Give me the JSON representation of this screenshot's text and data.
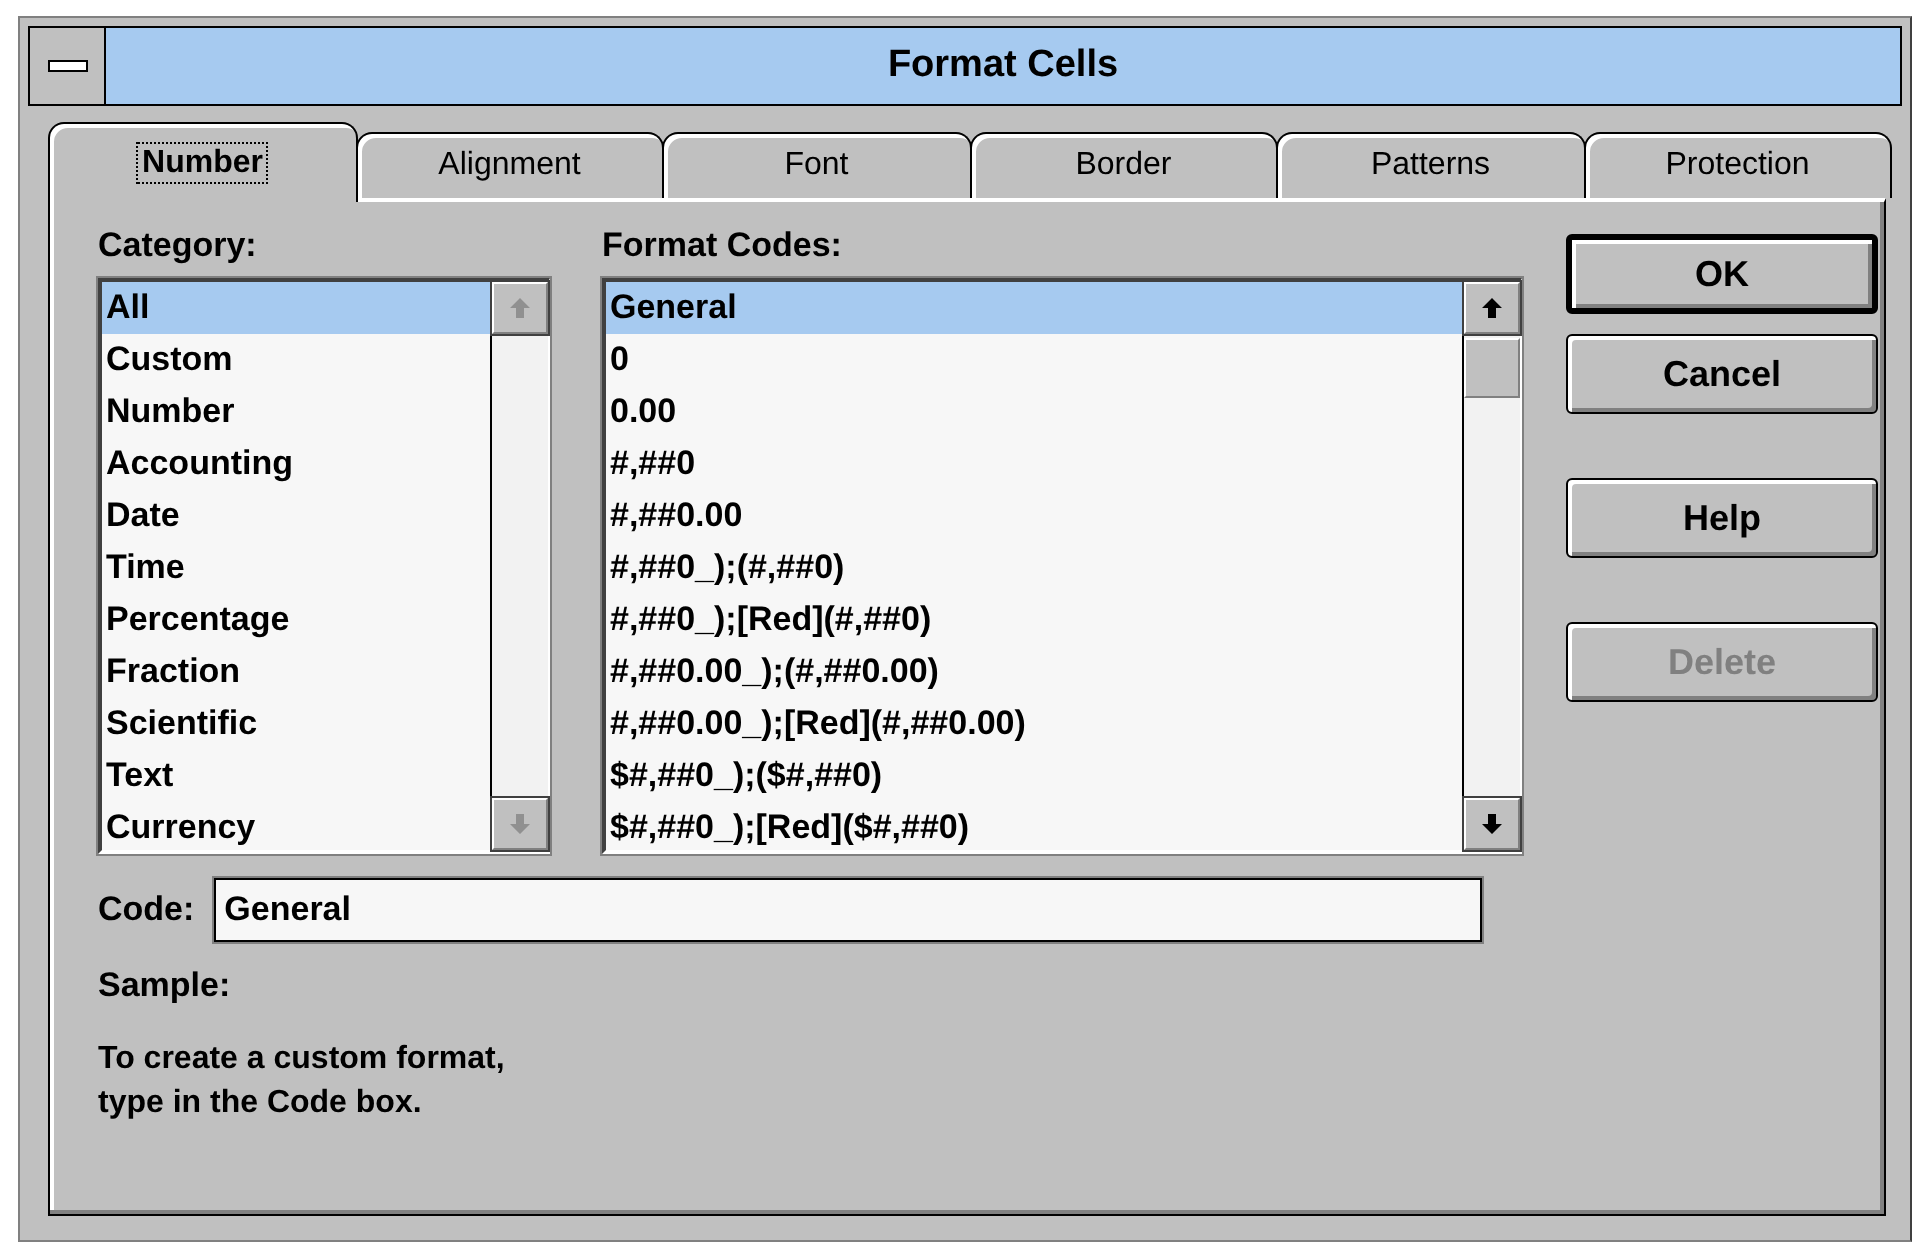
{
  "window": {
    "title": "Format Cells"
  },
  "tabs": [
    {
      "label": "Number",
      "selected": true
    },
    {
      "label": "Alignment",
      "selected": false
    },
    {
      "label": "Font",
      "selected": false
    },
    {
      "label": "Border",
      "selected": false
    },
    {
      "label": "Patterns",
      "selected": false
    },
    {
      "label": "Protection",
      "selected": false
    }
  ],
  "category": {
    "label": "Category:",
    "scrollable": false,
    "items": [
      {
        "label": "All",
        "selected": true
      },
      {
        "label": "Custom",
        "selected": false
      },
      {
        "label": "Number",
        "selected": false
      },
      {
        "label": "Accounting",
        "selected": false
      },
      {
        "label": "Date",
        "selected": false
      },
      {
        "label": "Time",
        "selected": false
      },
      {
        "label": "Percentage",
        "selected": false
      },
      {
        "label": "Fraction",
        "selected": false
      },
      {
        "label": "Scientific",
        "selected": false
      },
      {
        "label": "Text",
        "selected": false
      },
      {
        "label": "Currency",
        "selected": false
      }
    ]
  },
  "format_codes": {
    "label": "Format Codes:",
    "scrollable": true,
    "items": [
      {
        "label": "General",
        "selected": true
      },
      {
        "label": "0",
        "selected": false
      },
      {
        "label": "0.00",
        "selected": false
      },
      {
        "label": "#,##0",
        "selected": false
      },
      {
        "label": "#,##0.00",
        "selected": false
      },
      {
        "label": "#,##0_);(#,##0)",
        "selected": false
      },
      {
        "label": "#,##0_);[Red](#,##0)",
        "selected": false
      },
      {
        "label": "#,##0.00_);(#,##0.00)",
        "selected": false
      },
      {
        "label": "#,##0.00_);[Red](#,##0.00)",
        "selected": false
      },
      {
        "label": "$#,##0_);($#,##0)",
        "selected": false
      },
      {
        "label": "$#,##0_);[Red]($#,##0)",
        "selected": false
      }
    ]
  },
  "code": {
    "label": "Code:",
    "value": "General"
  },
  "sample": {
    "label": "Sample:"
  },
  "hint": "To create a custom format,\ntype in the Code box.",
  "buttons": [
    {
      "label": "OK",
      "default": true,
      "disabled": false
    },
    {
      "label": "Cancel",
      "default": false,
      "disabled": false
    },
    {
      "label": "Help",
      "default": false,
      "disabled": false
    },
    {
      "label": "Delete",
      "default": false,
      "disabled": true
    }
  ]
}
